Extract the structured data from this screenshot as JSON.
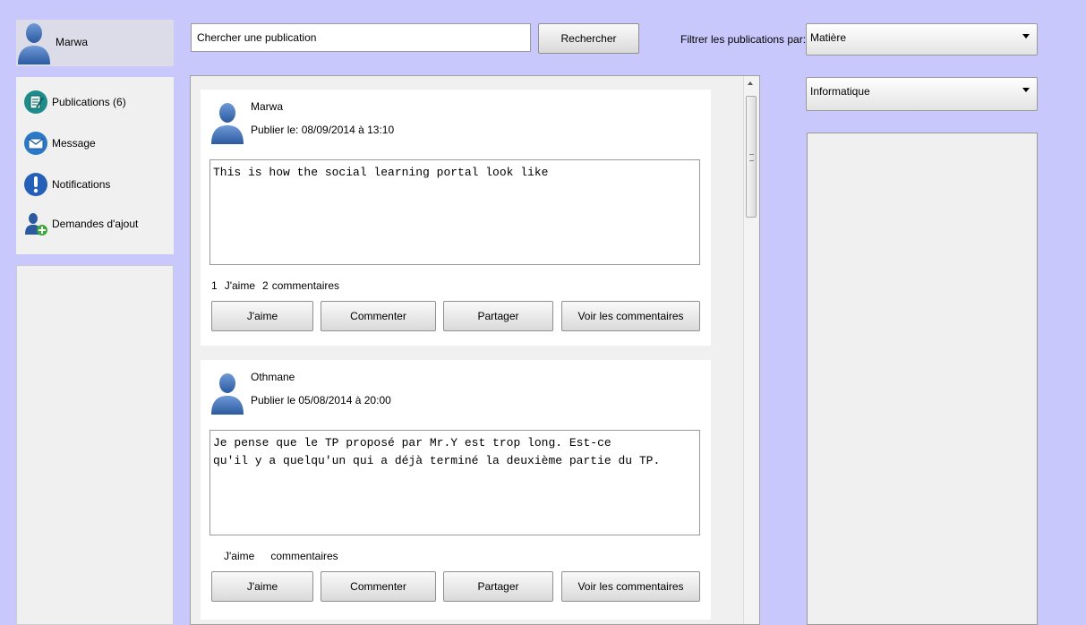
{
  "profile": {
    "name": "Marwa"
  },
  "sidebar": {
    "items": [
      {
        "label": "Publications (6)",
        "icon": "publications-icon"
      },
      {
        "label": "Message",
        "icon": "mail-icon"
      },
      {
        "label": "Notifications",
        "icon": "exclamation-icon"
      },
      {
        "label": "Demandes d'ajout",
        "icon": "add-user-icon"
      }
    ]
  },
  "search": {
    "value": "Chercher une publication",
    "button": "Rechercher"
  },
  "filter": {
    "label": "Filtrer les publications par:",
    "primary": "Matière",
    "secondary": "Informatique"
  },
  "posts": [
    {
      "author": "Marwa",
      "date": "Publier le: 08/09/2014 à 13:10",
      "body": "This is how the social learning portal look like",
      "likes_count": "1",
      "likes_label": "J'aime",
      "comments_count": "2",
      "comments_label": "commentaires",
      "buttons": {
        "like": "J'aime",
        "comment": "Commenter",
        "share": "Partager",
        "view": "Voir les commentaires"
      }
    },
    {
      "author": "Othmane",
      "date": "Publier le 05/08/2014 à 20:00",
      "body": "Je pense que le TP proposé par Mr.Y est trop long. Est-ce\nqu'il y a quelqu'un qui a déjà terminé la deuxième partie du TP.",
      "likes_count": "",
      "likes_label": "J'aime",
      "comments_count": "",
      "comments_label": "commentaires",
      "buttons": {
        "like": "J'aime",
        "comment": "Commenter",
        "share": "Partager",
        "view": "Voir les commentaires"
      }
    }
  ],
  "colors": {
    "background": "#c8c8fc",
    "panel": "#f0f0f0",
    "avatar": "#3f6fb5"
  }
}
